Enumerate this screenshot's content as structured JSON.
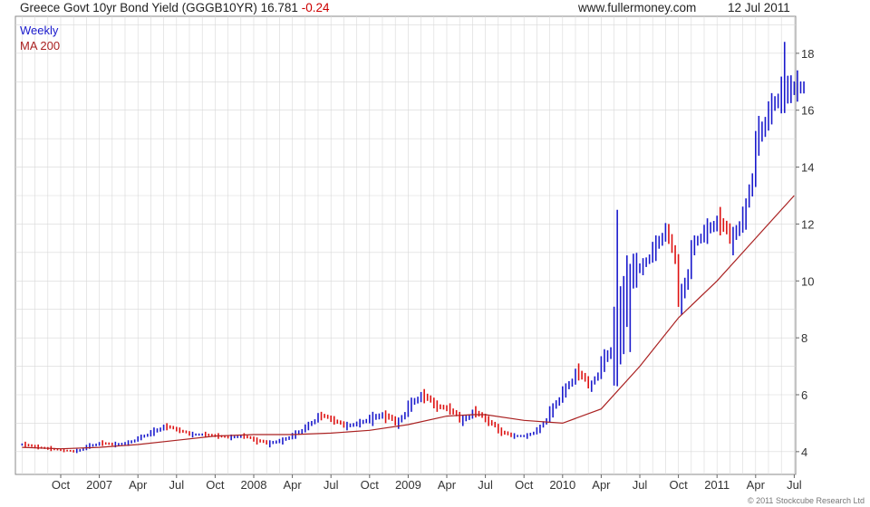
{
  "header": {
    "title": "Greece Govt 10yr Bond Yield (GGGB10YR)",
    "last": "16.781",
    "change": "-0.24",
    "site": "www.fullermoney.com",
    "date": "12 Jul 2011"
  },
  "legend": {
    "weekly": "Weekly",
    "ma": "MA 200"
  },
  "copyright": "© 2011 Stockcube Research Ltd",
  "colors": {
    "up": "#1a1acc",
    "down": "#dd1111",
    "ma": "#aa2222",
    "grid": "#d8d8d8"
  },
  "chart_data": {
    "type": "line",
    "title": "Greece Govt 10yr Bond Yield (GGGB10YR)",
    "xlabel": "",
    "ylabel": "",
    "ylim": [
      3.2,
      19.3
    ],
    "yticks": [
      4,
      6,
      8,
      10,
      12,
      14,
      16,
      18
    ],
    "y_axis_position": "right",
    "grid": true,
    "legend_position": "top-left",
    "x_tick_labels": [
      "Oct",
      "2007",
      "Apr",
      "Jul",
      "Oct",
      "2008",
      "Apr",
      "Jul",
      "Oct",
      "2009",
      "Apr",
      "Jul",
      "Oct",
      "2010",
      "Apr",
      "Jul",
      "Oct",
      "2011",
      "Apr",
      "Jul"
    ],
    "series": [
      {
        "name": "Weekly",
        "style": "high-low bars (up blue, down red)",
        "x": [
          "2006-07",
          "2006-08",
          "2006-09",
          "2006-10",
          "2006-11",
          "2006-12",
          "2007-01",
          "2007-02",
          "2007-03",
          "2007-04",
          "2007-05",
          "2007-06",
          "2007-07",
          "2007-08",
          "2007-09",
          "2007-10",
          "2007-11",
          "2007-12",
          "2008-01",
          "2008-02",
          "2008-03",
          "2008-04",
          "2008-05",
          "2008-06",
          "2008-07",
          "2008-08",
          "2008-09",
          "2008-10",
          "2008-11",
          "2008-12",
          "2009-01",
          "2009-02",
          "2009-03",
          "2009-04",
          "2009-05",
          "2009-06",
          "2009-07",
          "2009-08",
          "2009-09",
          "2009-10",
          "2009-11",
          "2009-12",
          "2010-01",
          "2010-02",
          "2010-03",
          "2010-04",
          "2010-05",
          "2010-06",
          "2010-07",
          "2010-08",
          "2010-09",
          "2010-10",
          "2010-11",
          "2010-12",
          "2011-01",
          "2011-02",
          "2011-03",
          "2011-04",
          "2011-05",
          "2011-06",
          "2011-07"
        ],
        "values": [
          4.25,
          4.15,
          4.1,
          4.05,
          4.0,
          4.2,
          4.3,
          4.25,
          4.3,
          4.5,
          4.7,
          4.9,
          4.75,
          4.6,
          4.6,
          4.55,
          4.5,
          4.55,
          4.4,
          4.3,
          4.4,
          4.6,
          4.9,
          5.3,
          5.1,
          4.9,
          5.0,
          5.2,
          5.3,
          5.0,
          5.7,
          6.0,
          5.6,
          5.5,
          5.1,
          5.4,
          5.1,
          4.7,
          4.55,
          4.55,
          4.8,
          5.5,
          6.2,
          6.8,
          6.3,
          7.2,
          7.9,
          10.3,
          10.5,
          11.2,
          11.9,
          9.3,
          11.3,
          11.8,
          12.1,
          11.5,
          12.4,
          15.0,
          16.1,
          16.7,
          16.8
        ],
        "lows": [
          4.15,
          4.08,
          4.02,
          3.98,
          3.95,
          4.1,
          4.2,
          4.15,
          4.2,
          4.4,
          4.55,
          4.75,
          4.65,
          4.5,
          4.5,
          4.45,
          4.4,
          4.45,
          4.25,
          4.15,
          4.25,
          4.45,
          4.75,
          5.1,
          4.95,
          4.75,
          4.85,
          4.9,
          5.0,
          4.8,
          5.4,
          5.7,
          5.4,
          5.3,
          4.9,
          5.2,
          4.9,
          4.55,
          4.45,
          4.45,
          4.65,
          5.2,
          5.9,
          6.5,
          6.1,
          6.8,
          6.3,
          7.5,
          10.2,
          10.7,
          11.3,
          8.8,
          10.9,
          11.3,
          11.6,
          10.9,
          11.8,
          14.4,
          15.5,
          15.9,
          16.3
        ],
        "highs": [
          4.35,
          4.25,
          4.2,
          4.12,
          4.1,
          4.3,
          4.4,
          4.35,
          4.4,
          4.6,
          4.85,
          5.0,
          4.85,
          4.7,
          4.7,
          4.65,
          4.6,
          4.65,
          4.5,
          4.4,
          4.5,
          4.75,
          5.05,
          5.4,
          5.25,
          5.05,
          5.15,
          5.4,
          5.45,
          5.2,
          5.9,
          6.2,
          5.8,
          5.7,
          5.3,
          5.6,
          5.25,
          4.85,
          4.65,
          4.65,
          4.95,
          5.7,
          6.4,
          7.1,
          6.5,
          7.6,
          12.5,
          10.6,
          10.8,
          11.6,
          12.0,
          9.9,
          11.6,
          12.2,
          12.6,
          11.9,
          12.9,
          15.8,
          16.6,
          18.4,
          17.4
        ]
      },
      {
        "name": "MA 200",
        "x": [
          "2006-07",
          "2006-10",
          "2007-01",
          "2007-04",
          "2007-07",
          "2007-10",
          "2008-01",
          "2008-04",
          "2008-07",
          "2008-10",
          "2009-01",
          "2009-04",
          "2009-06",
          "2009-07",
          "2009-10",
          "2010-01",
          "2010-04",
          "2010-07",
          "2010-10",
          "2011-01",
          "2011-04",
          "2011-07"
        ],
        "values": [
          4.15,
          4.1,
          4.15,
          4.25,
          4.4,
          4.55,
          4.6,
          4.6,
          4.65,
          4.75,
          4.95,
          5.25,
          5.3,
          5.3,
          5.1,
          5.0,
          5.5,
          7.0,
          8.7,
          10.0,
          11.5,
          13.0
        ]
      }
    ]
  }
}
